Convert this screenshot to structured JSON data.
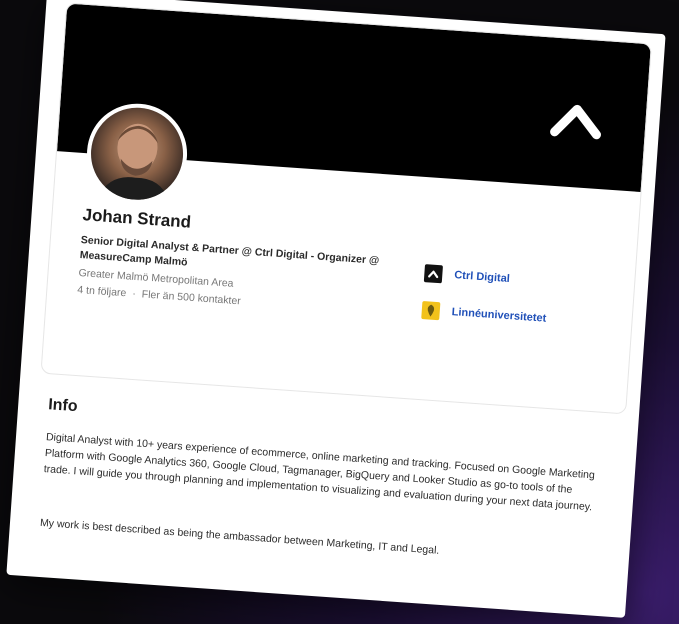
{
  "profile": {
    "name": "Johan Strand",
    "headline": "Senior Digital Analyst & Partner @ Ctrl Digital - Organizer @ MeasureCamp Malmö",
    "location": "Greater Malmö Metropolitan Area",
    "followers": "4 tn följare",
    "separator": "·",
    "connections": "Fler än 500 kontakter",
    "organizations": [
      {
        "name": "Ctrl Digital",
        "icon": "ctrl-digital-logo-icon"
      },
      {
        "name": "Linnéuniversitetet",
        "icon": "linneuniversitetet-logo-icon"
      }
    ],
    "banner_icon": "chevron-logo-icon"
  },
  "info": {
    "title": "Info",
    "paragraph1": "Digital Analyst with 10+ years experience of ecommerce, online marketing and tracking. Focused on Google Marketing Platform with Google Analytics 360, Google Cloud, Tagmanager, BigQuery and Looker Studio as go-to tools of the trade. I will guide you through planning and implementation to visualizing and evaluation during your next data journey.",
    "paragraph2": "My work is best described as being the ambassador between Marketing, IT and Legal."
  },
  "colors": {
    "banner": "#000000",
    "link": "#2050b8",
    "background_accent": "#3a1d6b"
  }
}
